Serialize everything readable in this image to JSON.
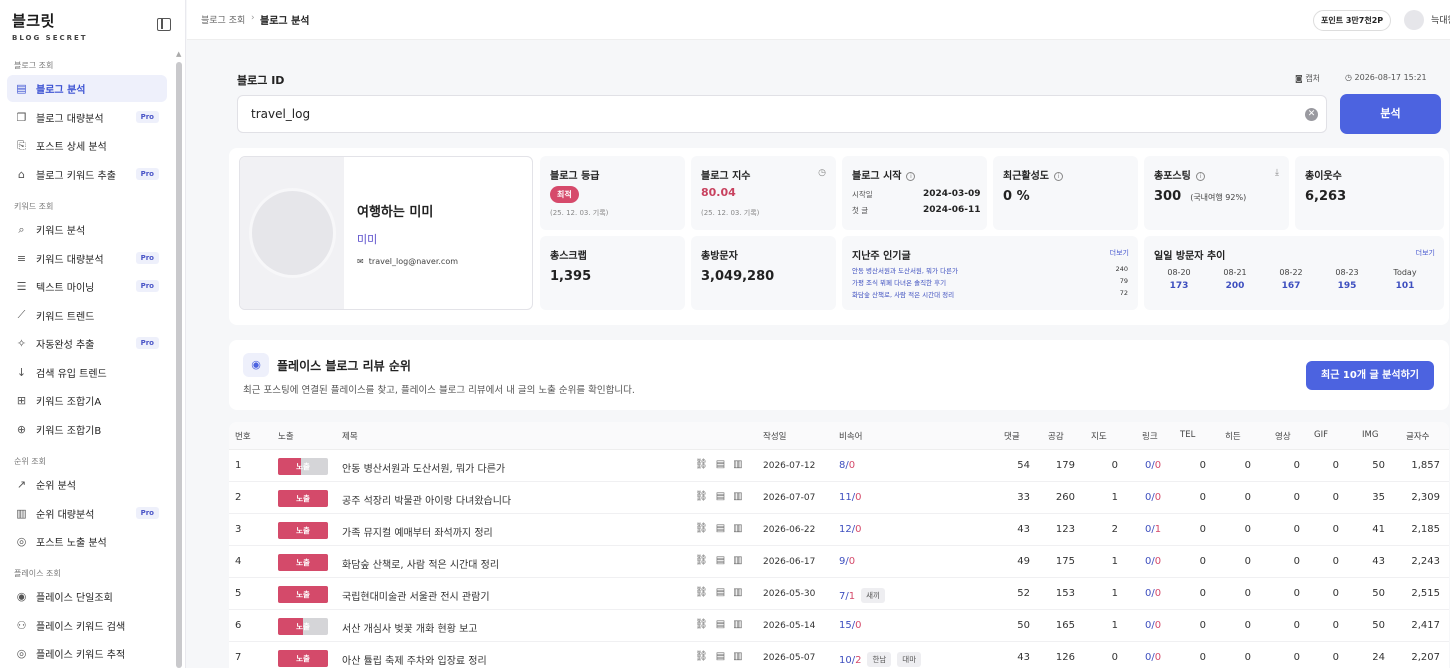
{
  "app": {
    "logo": "블크릿",
    "logo_sub": "BLOG SECRET"
  },
  "sidebar": {
    "sections": [
      {
        "label": "블로그 조회",
        "items": [
          {
            "label": "블로그 분석",
            "icon": "document-icon",
            "pro": false,
            "active": true
          },
          {
            "label": "블로그 대량분석",
            "icon": "copy-icon",
            "pro": true,
            "active": false
          },
          {
            "label": "포스트 상세 분석",
            "icon": "file-search-icon",
            "pro": false,
            "active": false
          },
          {
            "label": "블로그 키워드 추출",
            "icon": "tag-icon",
            "pro": true,
            "active": false
          }
        ]
      },
      {
        "label": "키워드 조회",
        "items": [
          {
            "label": "키워드 분석",
            "icon": "search-icon",
            "pro": false,
            "active": false
          },
          {
            "label": "키워드 대량분석",
            "icon": "filter-icon",
            "pro": true,
            "active": false
          },
          {
            "label": "텍스트 마이닝",
            "icon": "text-search-icon",
            "pro": true,
            "active": false
          },
          {
            "label": "키워드 트렌드",
            "icon": "trend-chart-icon",
            "pro": false,
            "active": false
          },
          {
            "label": "자동완성 추출",
            "icon": "magic-wand-icon",
            "pro": true,
            "active": false
          },
          {
            "label": "검색 유입 트렌드",
            "icon": "download-arrow-icon",
            "pro": false,
            "active": false
          },
          {
            "label": "키워드 조합기A",
            "icon": "combine-icon",
            "pro": false,
            "active": false
          },
          {
            "label": "키워드 조합기B",
            "icon": "combine-plus-icon",
            "pro": false,
            "active": false
          }
        ]
      },
      {
        "label": "순위 조회",
        "items": [
          {
            "label": "순위 분석",
            "icon": "trending-up-icon",
            "pro": false,
            "active": false
          },
          {
            "label": "순위 대량분석",
            "icon": "bar-chart-icon",
            "pro": true,
            "active": false
          },
          {
            "label": "포스트 노출 분석",
            "icon": "eye-icon",
            "pro": false,
            "active": false
          }
        ]
      },
      {
        "label": "플레이스 조회",
        "items": [
          {
            "label": "플레이스 단일조회",
            "icon": "map-pin-icon",
            "pro": false,
            "active": false
          },
          {
            "label": "플레이스 키워드 검색",
            "icon": "person-search-icon",
            "pro": false,
            "active": false
          },
          {
            "label": "플레이스 키워드 추적",
            "icon": "target-icon",
            "pro": false,
            "active": false
          }
        ]
      }
    ],
    "pro_label": "Pro"
  },
  "topbar": {
    "breadcrumb_parent": "블로그 조회",
    "breadcrumb_sep": "›",
    "breadcrumb_current": "블로그 분석",
    "points": "포인트 3만7천2P",
    "username": "늑대왕"
  },
  "form": {
    "label": "블로그 ID",
    "capture": "캡처",
    "datetime": "2026-08-17 15:21",
    "input_value": "travel_log",
    "analyze_button": "분석"
  },
  "profile": {
    "name": "여행하는 미미",
    "nickname": "미미",
    "email": "travel_log@naver.com"
  },
  "stats": {
    "grade": {
      "title": "블로그 등급",
      "badge": "최적",
      "note": "(25. 12. 03. 기록)"
    },
    "index": {
      "title": "블로그 지수",
      "value": "80.04",
      "note": "(25. 12. 03. 기록)"
    },
    "start": {
      "title": "블로그 시작",
      "start_label": "시작일",
      "start_value": "2024-03-09",
      "first_label": "첫 글",
      "first_value": "2024-06-11"
    },
    "activity": {
      "title": "최근활성도",
      "value": "0 %"
    },
    "posts": {
      "title": "총포스팅",
      "value": "300",
      "sub": "(국내여행 92%)"
    },
    "neighbors": {
      "title": "총이웃수",
      "value": "6,263"
    },
    "scraps": {
      "title": "총스크랩",
      "value": "1,395"
    },
    "visitors": {
      "title": "총방문자",
      "value": "3,049,280"
    },
    "popular": {
      "title": "지난주 인기글",
      "more": "더보기",
      "items": [
        {
          "title": "안동 병산서원과 도산서원, 뭐가 다른가",
          "count": "240"
        },
        {
          "title": "가평 조식 뷔페 다녀온 솔직한 후기",
          "count": "79"
        },
        {
          "title": "화담숲 산책로, 사람 적은 시간대 정리",
          "count": "72"
        }
      ]
    },
    "daily": {
      "title": "일일 방문자 추이",
      "more": "더보기",
      "days": [
        {
          "date": "08-20",
          "value": "173"
        },
        {
          "date": "08-21",
          "value": "200"
        },
        {
          "date": "08-22",
          "value": "167"
        },
        {
          "date": "08-23",
          "value": "195"
        },
        {
          "date": "Today",
          "value": "101"
        }
      ]
    }
  },
  "place": {
    "title": "플레이스 블로그 리뷰 순위",
    "desc": "최근 포스팅에 연결된 플레이스를 찾고, 플레이스 블로그 리뷰에서 내 글의 노출 순위를 확인합니다.",
    "button": "최근 10개 글 분석하기"
  },
  "table": {
    "headers": [
      "번호",
      "노출",
      "제목",
      "작성일",
      "비속어",
      "댓글",
      "공감",
      "지도",
      "링크",
      "TEL",
      "히든",
      "영상",
      "GIF",
      "IMG",
      "글자수"
    ],
    "rows": [
      {
        "no": "1",
        "expo_label": "노출",
        "expo_fill": 0.45,
        "title": "안동 병산서원과 도산서원, 뭐가 다른가",
        "date": "2026-07-12",
        "bad_a": "8",
        "bad_b": "0",
        "tags": [],
        "comments": "54",
        "likes": "179",
        "map": "0",
        "link_a": "0",
        "link_b": "0",
        "tel": "0",
        "hidden": "0",
        "video": "0",
        "gif": "0",
        "img": "50",
        "chars": "1,857"
      },
      {
        "no": "2",
        "expo_label": "노출",
        "expo_fill": 1.0,
        "title": "공주 석장리 박물관 아이랑 다녀왔습니다",
        "date": "2026-07-07",
        "bad_a": "11",
        "bad_b": "0",
        "tags": [],
        "comments": "33",
        "likes": "260",
        "map": "1",
        "link_a": "0",
        "link_b": "0",
        "tel": "0",
        "hidden": "0",
        "video": "0",
        "gif": "0",
        "img": "35",
        "chars": "2,309"
      },
      {
        "no": "3",
        "expo_label": "노출",
        "expo_fill": 1.0,
        "title": "가족 뮤지컬 예매부터 좌석까지 정리",
        "date": "2026-06-22",
        "bad_a": "12",
        "bad_b": "0",
        "tags": [],
        "comments": "43",
        "likes": "123",
        "map": "2",
        "link_a": "0",
        "link_b": "1",
        "tel": "0",
        "hidden": "0",
        "video": "0",
        "gif": "0",
        "img": "41",
        "chars": "2,185"
      },
      {
        "no": "4",
        "expo_label": "노출",
        "expo_fill": 1.0,
        "title": "화담숲 산책로, 사람 적은 시간대 정리",
        "date": "2026-06-17",
        "bad_a": "9",
        "bad_b": "0",
        "tags": [],
        "comments": "49",
        "likes": "175",
        "map": "1",
        "link_a": "0",
        "link_b": "0",
        "tel": "0",
        "hidden": "0",
        "video": "0",
        "gif": "0",
        "img": "43",
        "chars": "2,243"
      },
      {
        "no": "5",
        "expo_label": "노출",
        "expo_fill": 1.0,
        "title": "국립현대미술관 서울관 전시 관람기",
        "date": "2026-05-30",
        "bad_a": "7",
        "bad_b": "1",
        "tags": [
          "새끼"
        ],
        "comments": "52",
        "likes": "153",
        "map": "1",
        "link_a": "0",
        "link_b": "0",
        "tel": "0",
        "hidden": "0",
        "video": "0",
        "gif": "0",
        "img": "50",
        "chars": "2,515"
      },
      {
        "no": "6",
        "expo_label": "노출",
        "expo_fill": 0.5,
        "title": "서산 개심사 벚꽃 개화 현황 보고",
        "date": "2026-05-14",
        "bad_a": "15",
        "bad_b": "0",
        "tags": [],
        "comments": "50",
        "likes": "165",
        "map": "1",
        "link_a": "0",
        "link_b": "0",
        "tel": "0",
        "hidden": "0",
        "video": "0",
        "gif": "0",
        "img": "50",
        "chars": "2,417"
      },
      {
        "no": "7",
        "expo_label": "노출",
        "expo_fill": 1.0,
        "title": "아산 튤립 축제 주차와 입장료 정리",
        "date": "2026-05-07",
        "bad_a": "10",
        "bad_b": "2",
        "tags": [
          "한남",
          "대마"
        ],
        "comments": "43",
        "likes": "126",
        "map": "0",
        "link_a": "0",
        "link_b": "0",
        "tel": "0",
        "hidden": "0",
        "video": "0",
        "gif": "0",
        "img": "24",
        "chars": "2,207"
      }
    ]
  }
}
